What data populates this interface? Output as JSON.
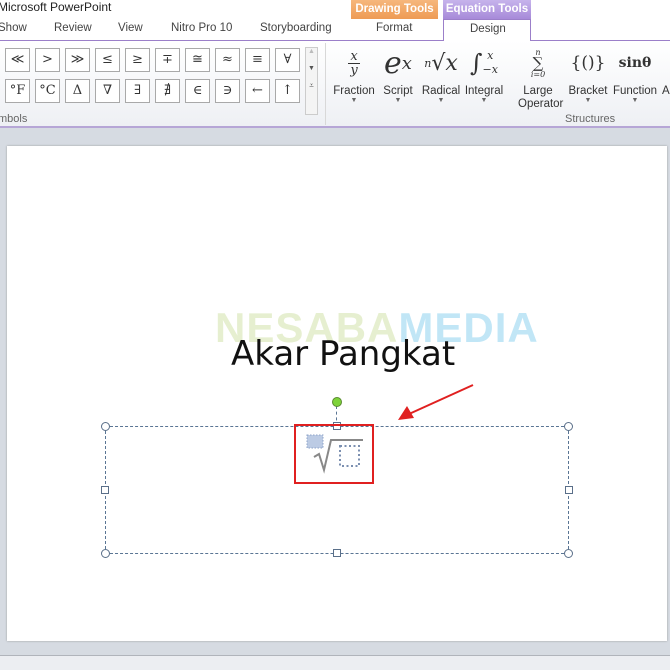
{
  "window": {
    "title": "Microsoft PowerPoint"
  },
  "tabs": [
    "Show",
    "Review",
    "View",
    "Nitro Pro 10",
    "Storyboarding"
  ],
  "contextual": {
    "drawing_tools": {
      "label": "Drawing Tools",
      "tab": "Format",
      "color": "#f0a35e"
    },
    "equation_tools": {
      "label": "Equation Tools",
      "tab": "Design",
      "color": "#b49be0"
    }
  },
  "symbols": {
    "group_label": "mbols",
    "row1": [
      "≪",
      ">",
      "≫",
      "≤",
      "≥",
      "∓",
      "≅",
      "≈",
      "≡",
      "∀"
    ],
    "row2": [
      "°F",
      "°C",
      "Δ",
      "∇",
      "∃",
      "∄",
      "∈",
      "∋",
      "←",
      "↑"
    ]
  },
  "structures": {
    "group_label": "Structures",
    "items": [
      {
        "label": "Fraction",
        "glyph": "x/y"
      },
      {
        "label": "Script",
        "glyph": "eˣ"
      },
      {
        "label": "Radical",
        "glyph": "ⁿ√x"
      },
      {
        "label": "Integral",
        "glyph": "∫"
      },
      {
        "label": "Large Operator",
        "glyph": "∑"
      },
      {
        "label": "Bracket",
        "glyph": "{()}"
      },
      {
        "label": "Function",
        "glyph": "sinθ"
      },
      {
        "label": "A",
        "glyph": ""
      }
    ]
  },
  "slide": {
    "title": "Akar Pangkat",
    "watermark": "NESABAMEDIA",
    "accent": "#e02020"
  }
}
